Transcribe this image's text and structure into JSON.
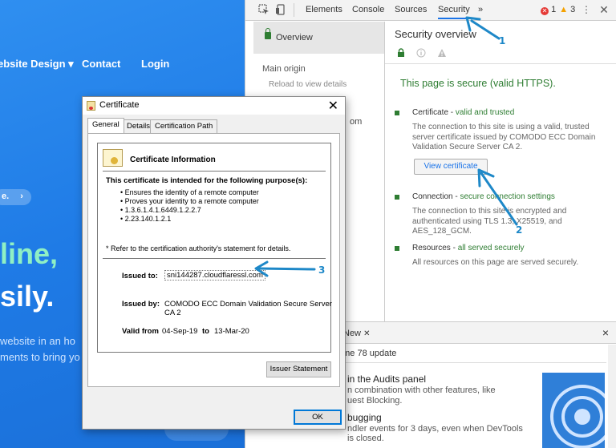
{
  "website": {
    "nav": {
      "design": "ebsite Design ▾",
      "contact": "Contact",
      "login": "Login"
    },
    "pill": "e.",
    "pill_chevron": "›",
    "headline1": "line,",
    "headline2": "sily.",
    "body_line1": "website in an ho",
    "body_line2": "ments to bring yo"
  },
  "devtools": {
    "tabs": [
      "Elements",
      "Console",
      "Sources",
      "Security"
    ],
    "active_tab": "Security",
    "more": "»",
    "errors": "1",
    "warnings": "3",
    "sidebar": {
      "overview": "Overview",
      "main_origin": "Main origin",
      "reload": "Reload to view details",
      "partial_text": "om"
    },
    "security": {
      "title": "Security overview",
      "secure_message": "This page is secure (valid HTTPS).",
      "certificate_head": "Certificate - ",
      "certificate_status": "valid and trusted",
      "certificate_desc": "The connection to this site is using a valid, trusted server certificate issued by COMODO ECC Domain Validation Secure Server CA 2.",
      "view_certificate": "View certificate",
      "connection_head": "Connection - ",
      "connection_status": "secure connection settings",
      "connection_desc": "The connection to this site is encrypted and authenticated using TLS 1.3, X25519, and AES_128_GCM.",
      "resources_head": "Resources - ",
      "resources_status": "all served securely",
      "resources_desc": "All resources on this page are served securely."
    },
    "drawer": {
      "tab": "New",
      "close": "×",
      "line1": "ome 78 update",
      "h1": " in the Audits panel",
      "t1": "n combination with other features, like",
      "t2": "uest Blocking.",
      "h2": "bugging",
      "t3": "ndler events for 3 days, even when DevTools",
      "t4": "is closed."
    }
  },
  "certificate_dialog": {
    "title": "Certificate",
    "close": "✕",
    "tabs": [
      "General",
      "Details",
      "Certification Path"
    ],
    "info_title": "Certificate Information",
    "purpose_heading": "This certificate is intended for the following purpose(s):",
    "purposes": [
      "• Ensures the identity of a remote computer",
      "• Proves your identity to a remote computer",
      "• 1.3.6.1.4.1.6449.1.2.2.7",
      "• 2.23.140.1.2.1"
    ],
    "refer_note": "* Refer to the certification authority's statement for details.",
    "issued_to_label": "Issued to:",
    "issued_to": "sni144287.cloudflaressl.com",
    "issued_by_label": "Issued by:",
    "issued_by_line1": "COMODO ECC Domain Validation Secure Server",
    "issued_by_line2": "CA 2",
    "valid_from_label": "Valid from",
    "valid_from": "04-Sep-19",
    "valid_to_label": "to",
    "valid_to": "13-Mar-20",
    "issuer_statement": "Issuer Statement",
    "ok": "OK"
  },
  "annotations": [
    "1",
    "2",
    "3"
  ],
  "colors": {
    "accent": "#1a73e8",
    "secure_green": "#2e7d32",
    "annotation_blue": "#1e88c8",
    "site_blue": "#1f7be6"
  }
}
